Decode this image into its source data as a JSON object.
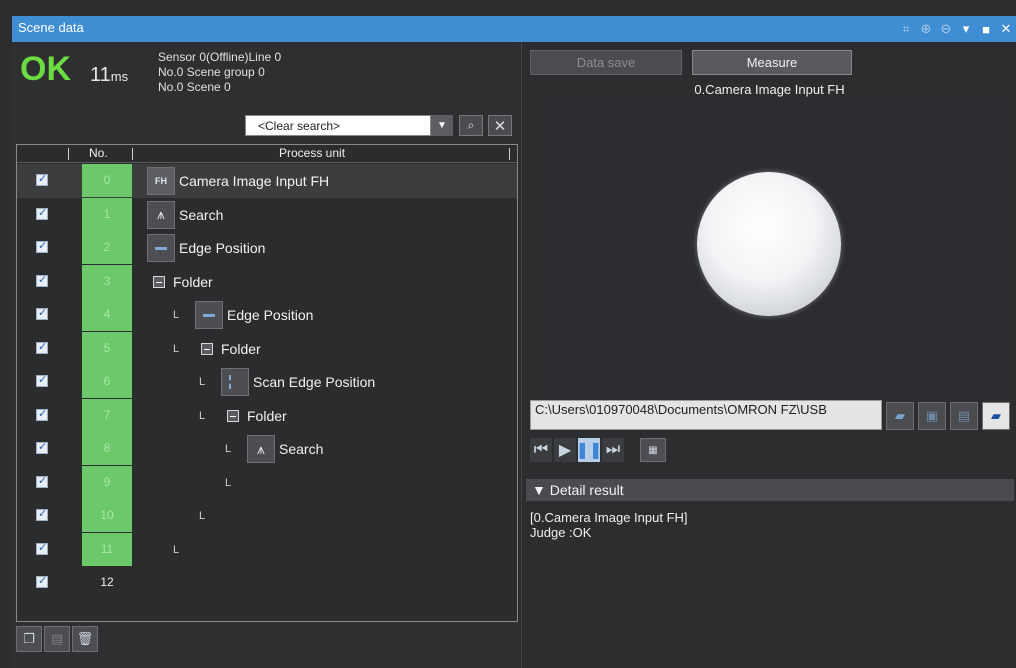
{
  "window": {
    "title": "Scene data",
    "title_icons": [
      "fit-icon",
      "zoom-in-icon",
      "zoom-out-icon",
      "dropdown-icon",
      "maximize-icon",
      "close-icon"
    ]
  },
  "status": {
    "judge": "OK",
    "time_value": "11",
    "time_unit": "ms",
    "sensor_line": "Sensor 0(Offline)Line 0",
    "scene_group": "No.0 Scene group 0",
    "scene": "No.0 Scene 0"
  },
  "search": {
    "value": "<Clear search>"
  },
  "grid": {
    "col_no": "No.",
    "col_unit": "Process unit",
    "rows": [
      {
        "no": "0",
        "label": "Camera Image Input FH",
        "icon": "camera-fh-icon",
        "indent": 0
      },
      {
        "no": "1",
        "label": "Search",
        "icon": "search-unit-icon",
        "indent": 0
      },
      {
        "no": "2",
        "label": "Edge Position",
        "icon": "edge-position-icon",
        "indent": 0
      },
      {
        "no": "3",
        "label": "Folder",
        "icon": "folder-collapse-icon",
        "indent": 0
      },
      {
        "no": "4",
        "label": "Edge Position",
        "icon": "edge-position-icon",
        "indent": 1
      },
      {
        "no": "5",
        "label": "Folder",
        "icon": "folder-collapse-icon",
        "indent": 1
      },
      {
        "no": "6",
        "label": "Scan Edge Position",
        "icon": "scan-edge-icon",
        "indent": 2
      },
      {
        "no": "7",
        "label": "Folder",
        "icon": "folder-collapse-icon",
        "indent": 2
      },
      {
        "no": "8",
        "label": "Search",
        "icon": "search-unit-icon",
        "indent": 3
      },
      {
        "no": "9",
        "label": "",
        "icon": "",
        "indent": 3
      },
      {
        "no": "10",
        "label": "",
        "icon": "",
        "indent": 2
      },
      {
        "no": "11",
        "label": "",
        "icon": "",
        "indent": 1
      },
      {
        "no": "12",
        "label": "",
        "icon": "",
        "indent": 0
      }
    ],
    "tree_mark": "L"
  },
  "toolbar_bottom": {
    "icons": [
      "copy-unit-icon",
      "paste-unit-icon",
      "delete-unit-icon"
    ]
  },
  "image_panel": {
    "data_save_label": "Data save",
    "measure_label": "Measure",
    "image_title": "0.Camera Image Input FH",
    "path": "C:\\Users\\010970048\\Documents\\OMRON FZ\\USB",
    "path_icons": [
      "open-folder-icon",
      "save-image-icon",
      "save-all-icon",
      "browse-folder-icon"
    ],
    "playback_icons": [
      "skip-start-icon",
      "play-icon",
      "pause-icon",
      "skip-end-icon",
      "csv-export-icon"
    ]
  },
  "detail": {
    "header": "Detail result",
    "lines": [
      "[0.Camera Image Input FH]",
      "Judge :OK"
    ]
  }
}
